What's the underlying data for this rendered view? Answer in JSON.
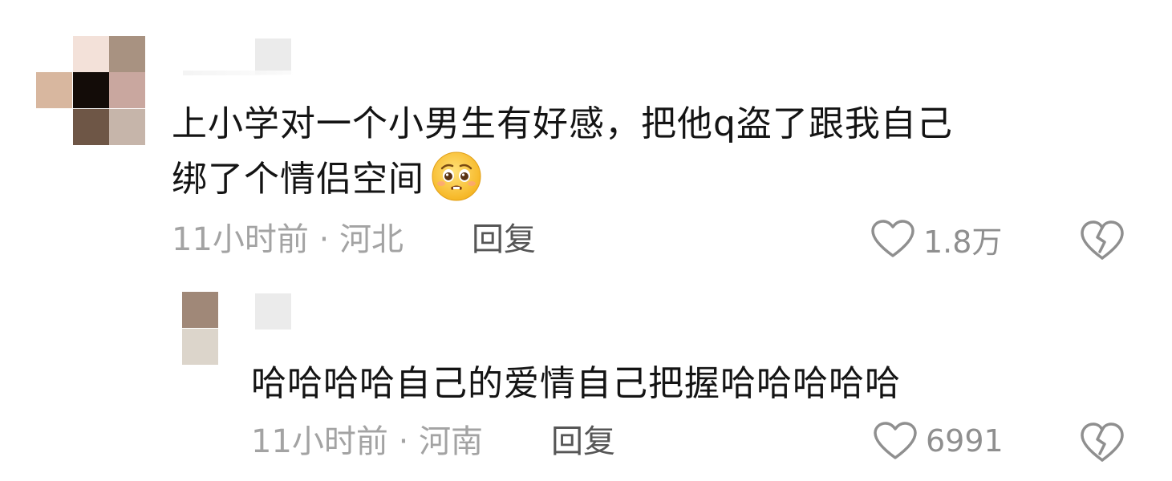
{
  "comments": [
    {
      "text_line1": "上小学对一个小男生有好感，把他q盗了跟我自己",
      "text_line2": "绑了个情侣空间",
      "emoji": "pleading-face-emoji",
      "time": "11小时前",
      "separator": "·",
      "location": "河北",
      "reply_label": "回复",
      "like_count": "1.8万",
      "avatar_colors": [
        "#f3e1d9",
        "#a89281",
        "#d8b79f",
        "#130c08",
        "#c9a79f",
        "#6e5646",
        "#c6b5aa"
      ]
    },
    {
      "text_line1": "哈哈哈哈自己的爱情自己把握哈哈哈哈哈",
      "time": "11小时前",
      "separator": "·",
      "location": "河南",
      "reply_label": "回复",
      "like_count": "6991",
      "avatar_colors": [
        "#a08878",
        "#dcd5cb"
      ]
    }
  ],
  "icons": {
    "like": "heart-outline-icon",
    "dislike": "broken-heart-icon"
  },
  "colors": {
    "text": "#141414",
    "meta": "#a3a3a3",
    "reply": "#565656",
    "icon": "#8f8f8f"
  }
}
